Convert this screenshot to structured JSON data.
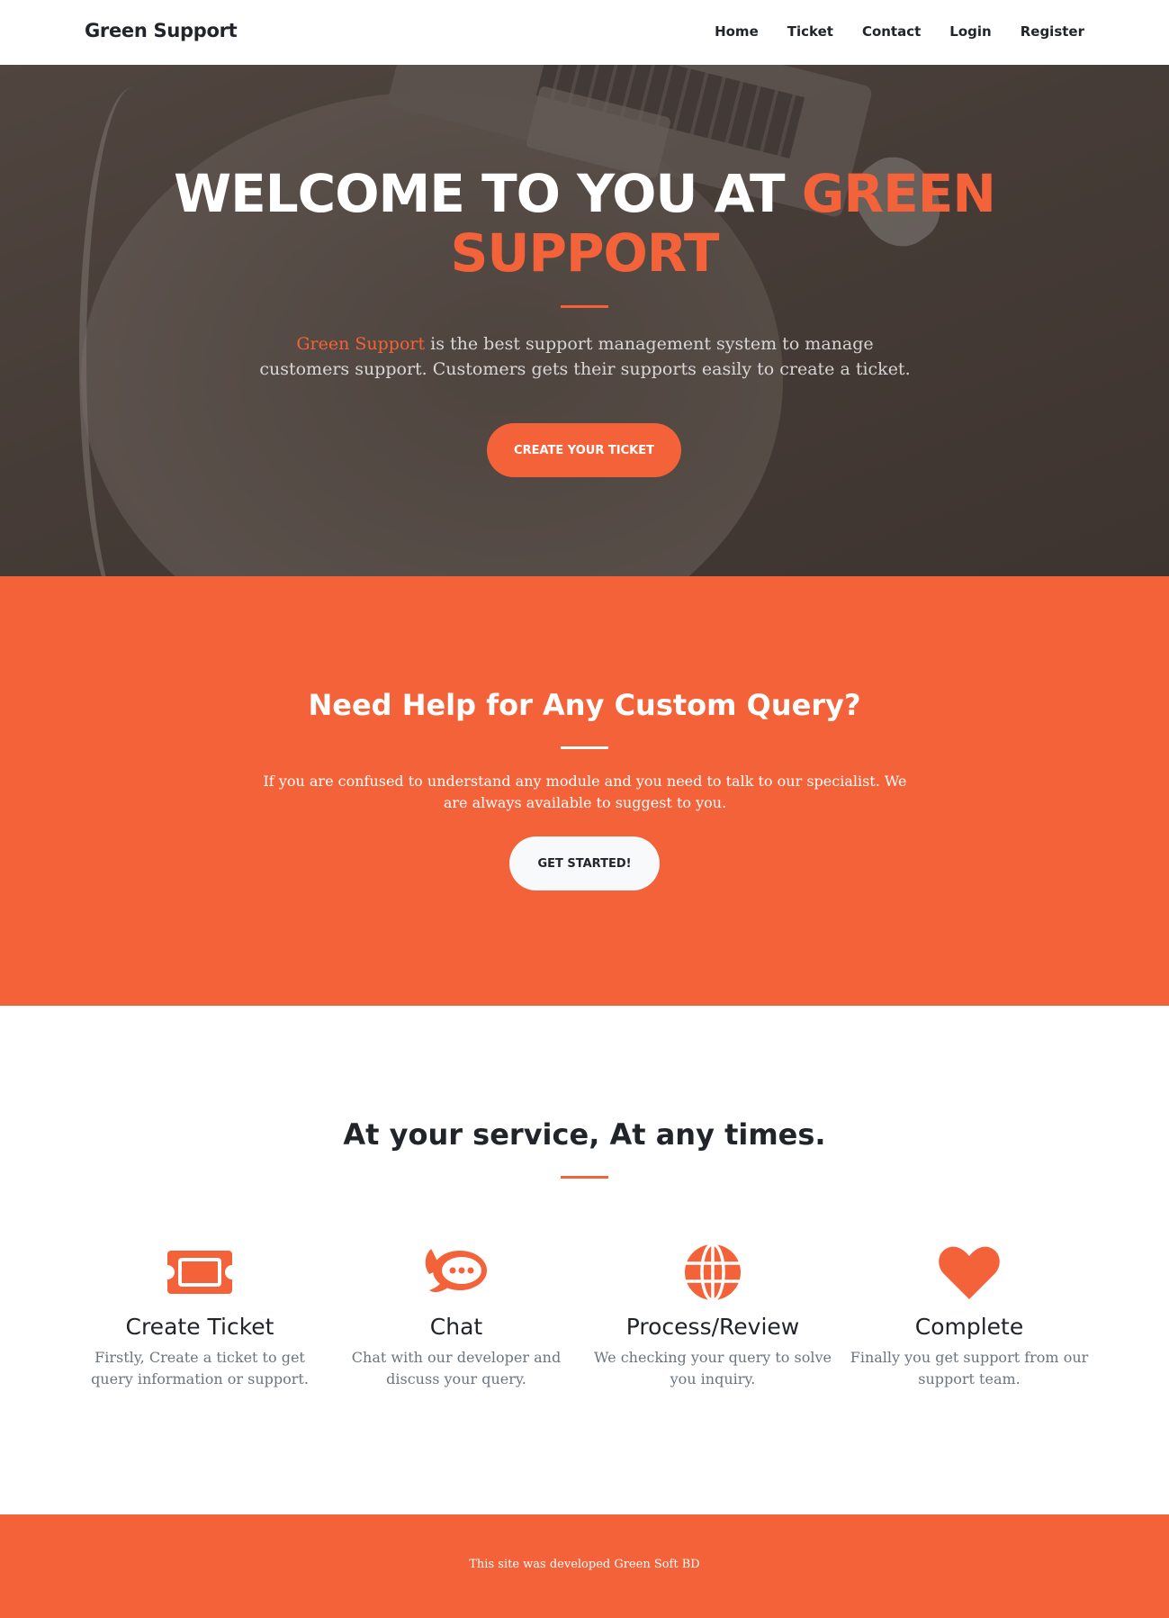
{
  "brand": "Green Support",
  "nav": {
    "items": [
      {
        "label": "Home"
      },
      {
        "label": "Ticket"
      },
      {
        "label": "Contact"
      },
      {
        "label": "Login"
      },
      {
        "label": "Register"
      }
    ]
  },
  "hero": {
    "title_line1": "WELCOME TO YOU AT ",
    "title_accent1": "GREEN",
    "title_accent2": "SUPPORT",
    "text_accent": "Green Support",
    "text": " is the best support management system to manage customers support. Customers gets their supports easily to create a ticket.",
    "button": "Create Your Ticket"
  },
  "help": {
    "title": "Need Help for Any Custom Query?",
    "text": "If you are confused to understand any module and you need to talk to our specialist. We are always available to suggest to you.",
    "button": "Get Started!"
  },
  "services": {
    "title": "At your service, At any times.",
    "items": [
      {
        "icon": "ticket-icon",
        "title": "Create Ticket",
        "text": "Firstly, Create a ticket to get query information or support."
      },
      {
        "icon": "chat-icon",
        "title": "Chat",
        "text": "Chat with our developer and discuss your query."
      },
      {
        "icon": "globe-icon",
        "title": "Process/Review",
        "text": "We checking your query to solve you inquiry."
      },
      {
        "icon": "heart-icon",
        "title": "Complete",
        "text": "Finally you get support from our support team."
      }
    ]
  },
  "footer": {
    "text": "This site was developed Green Soft BD"
  },
  "colors": {
    "primary": "#f4623a",
    "dark": "#212529",
    "muted": "#6c757d",
    "light": "#f8f9fa"
  }
}
